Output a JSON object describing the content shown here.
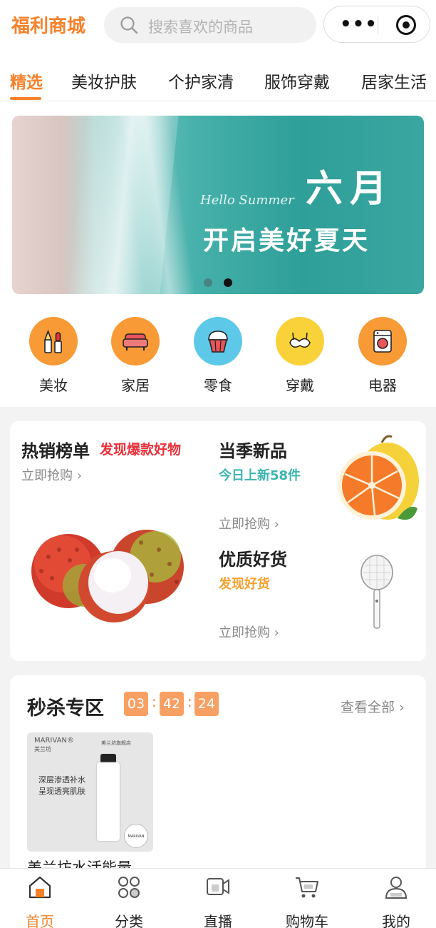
{
  "header": {
    "logo": "福利商城",
    "search_placeholder": "搜索喜欢的商品",
    "more_label": "•••"
  },
  "tabs": [
    {
      "label": "精选",
      "active": true
    },
    {
      "label": "美妆护肤",
      "active": false
    },
    {
      "label": "个护家清",
      "active": false
    },
    {
      "label": "服饰穿戴",
      "active": false
    },
    {
      "label": "居家生活",
      "active": false
    }
  ],
  "banner": {
    "hello": "Hello Summer",
    "month": "六月",
    "slogan": "开启美好夏天",
    "active_dot": 2,
    "dot_count": 2
  },
  "categories": [
    {
      "label": "美妆",
      "icon": "makeup-icon",
      "color": "#f89a35"
    },
    {
      "label": "家居",
      "icon": "sofa-icon",
      "color": "#f89a35"
    },
    {
      "label": "零食",
      "icon": "cupcake-icon",
      "color": "#5ec8e8"
    },
    {
      "label": "穿戴",
      "icon": "bra-icon",
      "color": "#f9d23a"
    },
    {
      "label": "电器",
      "icon": "washing-machine-icon",
      "color": "#f89a35"
    }
  ],
  "promo": {
    "hot": {
      "title": "热销榜单",
      "subtitle": "发现爆款好物",
      "action": "立即抢购",
      "image": "lychee-icon"
    },
    "new": {
      "title": "当季新品",
      "subtitle": "今日上新58件",
      "action": "立即抢购",
      "image": "orange-icon"
    },
    "quality": {
      "title": "优质好货",
      "subtitle": "发现好货",
      "action": "立即抢购",
      "image": "mosquito-swatter-icon"
    }
  },
  "flash_sale": {
    "title": "秒杀专区",
    "timer": {
      "hours": "03",
      "minutes": "42",
      "seconds": "24"
    },
    "view_all": "查看全部",
    "product": {
      "name": "美兰坊水活能量…",
      "brand": "MARIVAN®",
      "brand_cn": "美兰坊",
      "shop": "美兰坊旗舰店",
      "copy_line1": "深层渗透补水",
      "copy_line2": "呈现透亮肌肤",
      "seal": "MARIVAN"
    }
  },
  "bottom_nav": [
    {
      "label": "首页",
      "icon": "home-icon",
      "active": true
    },
    {
      "label": "分类",
      "icon": "category-icon",
      "active": false
    },
    {
      "label": "直播",
      "icon": "live-camera-icon",
      "active": false
    },
    {
      "label": "购物车",
      "icon": "cart-icon",
      "active": false
    },
    {
      "label": "我的",
      "icon": "profile-icon",
      "active": false
    }
  ],
  "colors": {
    "accent": "#f5822b",
    "hot_red": "#e8323c",
    "new_teal": "#3bb5b0",
    "quality_orange": "#f5a030"
  }
}
